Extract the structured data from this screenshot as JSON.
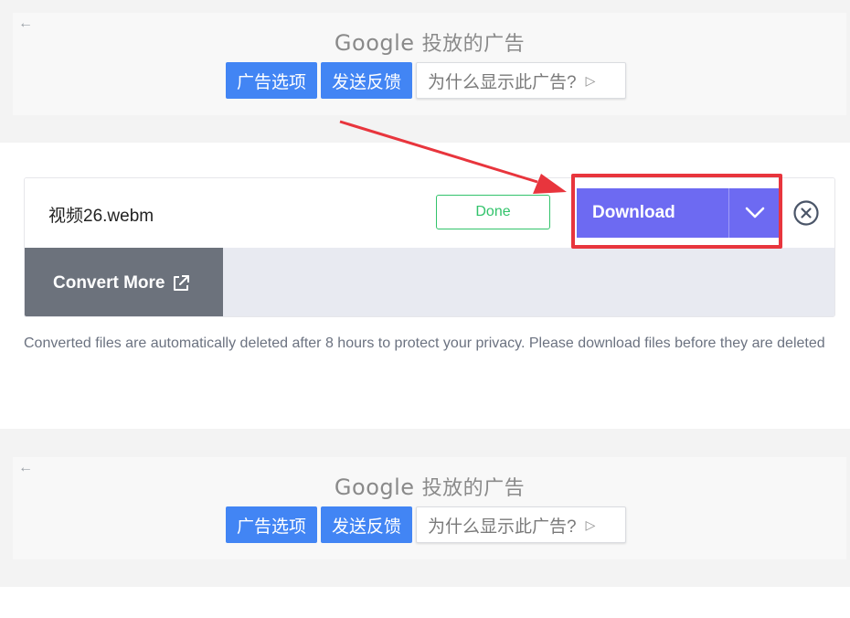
{
  "ads": [
    {
      "back_icon": "←",
      "brand": "Google",
      "suffix": "投放的广告",
      "buttons": [
        "广告选项",
        "发送反馈"
      ],
      "why_label": "为什么显示此广告?",
      "play_icon": "▷"
    },
    {
      "back_icon": "←",
      "brand": "Google",
      "suffix": "投放的广告",
      "buttons": [
        "广告选项",
        "发送反馈"
      ],
      "why_label": "为什么显示此广告?",
      "play_icon": "▷"
    }
  ],
  "file": {
    "name": "视频26.webm",
    "status": "Done",
    "download_label": "Download",
    "convert_more_label": "Convert More"
  },
  "privacy_note": "Converted files are automatically deleted after 8 hours to protect your privacy. Please download files before they are deleted",
  "colors": {
    "accent": "#6d6af2",
    "done": "#32c36b",
    "ad_blue": "#4285f4",
    "highlight": "#e8353d"
  }
}
